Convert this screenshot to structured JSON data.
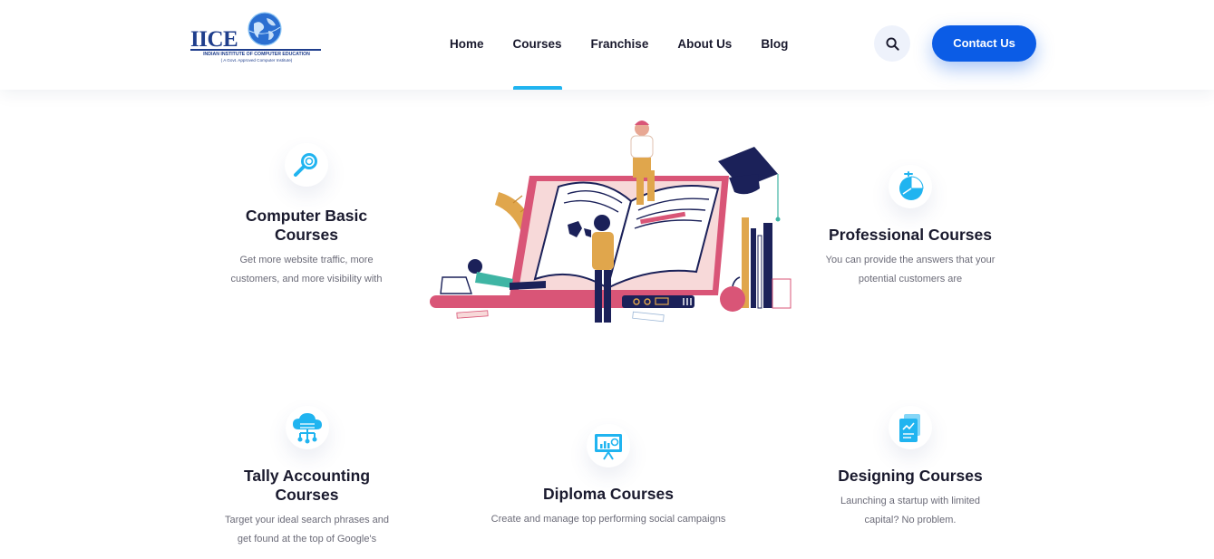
{
  "brand": {
    "logo_text": "IICE",
    "logo_subtitle": "INDIAN INSTITUTE OF COMPUTER EDUCATION",
    "logo_tagline": "( A Govt. Approved Computer Institute)"
  },
  "nav": {
    "items": [
      "Home",
      "Courses",
      "Franchise",
      "About Us",
      "Blog"
    ],
    "active": "Courses"
  },
  "header": {
    "search_icon": "search-icon",
    "contact_label": "Contact Us"
  },
  "colors": {
    "accent": "#20b4f0",
    "primary_button": "#0b5ce6",
    "heading": "#1a1a2e",
    "body_text": "#6b6b78"
  },
  "features": [
    {
      "icon": "magnifier-icon",
      "title_line1": "Computer Basic",
      "title_line2": "Courses",
      "desc_line1": "Get more website traffic, more",
      "desc_line2": "customers, and more visibility with"
    },
    {
      "icon": "pie-chart-icon",
      "title_line1": "Professional Courses",
      "title_line2": "",
      "desc_line1": "You can provide the answers that your",
      "desc_line2": "potential customers are"
    },
    {
      "icon": "cloud-network-icon",
      "title_line1": "Tally Accounting",
      "title_line2": "Courses",
      "desc_line1": "Target your ideal search phrases and",
      "desc_line2": "get found at the top of Google's"
    },
    {
      "icon": "presentation-board-icon",
      "title_line1": "Diploma Courses",
      "title_line2": "",
      "desc_line1": "Create and manage top performing social campaigns",
      "desc_line2": ""
    },
    {
      "icon": "document-chart-icon",
      "title_line1": "Designing Courses",
      "title_line2": "",
      "desc_line1": "Launching a startup with limited",
      "desc_line2": "capital? No problem."
    }
  ]
}
